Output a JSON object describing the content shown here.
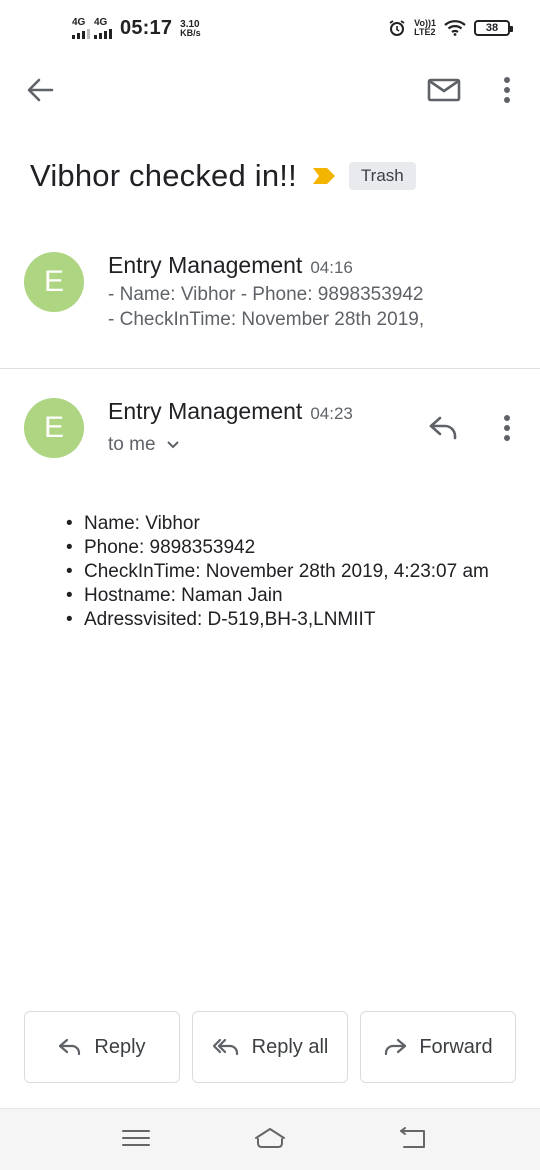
{
  "status_bar": {
    "network1": "4G",
    "network2": "4G",
    "time": "05:17",
    "speed_value": "3.10",
    "speed_unit": "KB/s",
    "volte_top": "Vo))1",
    "volte_bottom": "LTE2",
    "battery": "38"
  },
  "toolbar": {
    "back_icon": "arrow-left-icon",
    "mail_icon": "mail-icon",
    "more_icon": "more-vert-icon"
  },
  "subject": {
    "title": "Vibhor checked in!!",
    "label": "Trash",
    "important_color": "#f4b400"
  },
  "messages": [
    {
      "avatar_letter": "E",
      "sender": "Entry Management",
      "time": "04:16",
      "snippet_line1": "- Name: Vibhor - Phone: 9898353942",
      "snippet_line2": "- CheckInTime: November 28th 2019,"
    },
    {
      "avatar_letter": "E",
      "sender": "Entry Management",
      "time": "04:23",
      "recipient": "to me",
      "body": [
        "Name: Vibhor",
        "Phone: 9898353942",
        "CheckInTime: November 28th 2019, 4:23:07 am",
        "Hostname: Naman Jain",
        "Adressvisited: D-519,BH-3,LNMIIT"
      ]
    }
  ],
  "actions": {
    "reply": "Reply",
    "reply_all": "Reply all",
    "forward": "Forward"
  },
  "colors": {
    "avatar": "#aed581",
    "accent_important": "#f4b400"
  }
}
